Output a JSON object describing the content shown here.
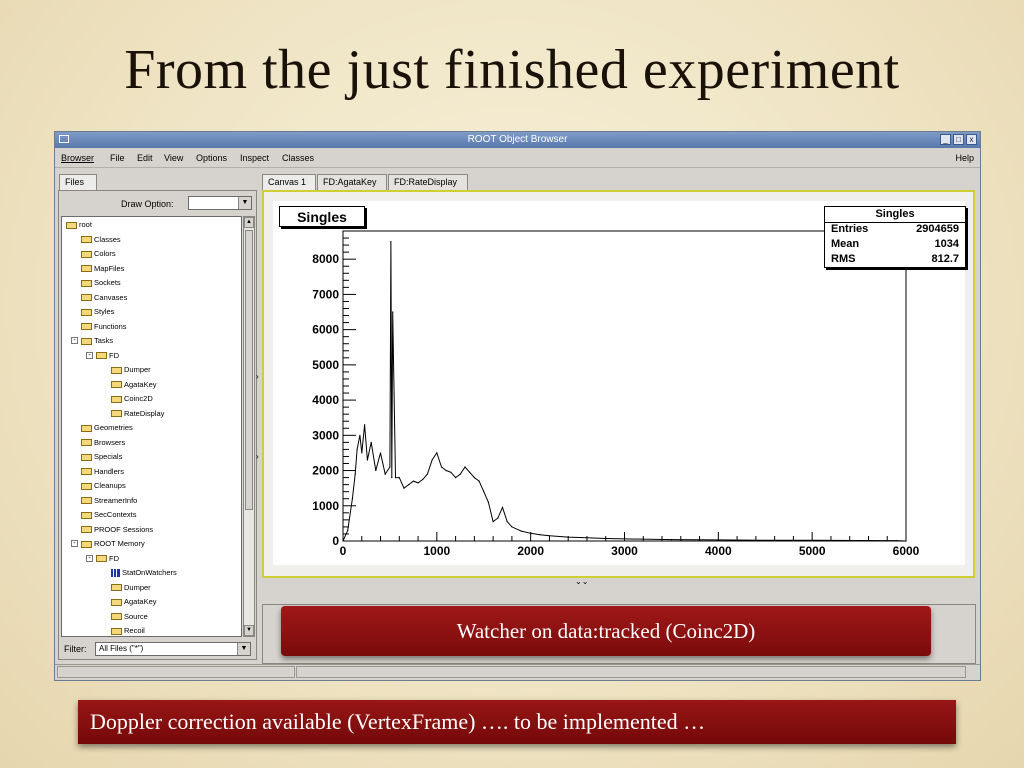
{
  "slide": {
    "title": "From the just finished experiment",
    "banner_watcher": "Watcher on data:tracked (Coinc2D)",
    "banner_doppler": "Doppler correction available (VertexFrame) …. to be implemented …"
  },
  "window": {
    "title": "ROOT Object Browser",
    "controls": [
      "_",
      "□",
      "x"
    ],
    "menu": [
      "Browser",
      "File",
      "Edit",
      "View",
      "Options",
      "Inspect",
      "Classes"
    ],
    "help": "Help"
  },
  "left": {
    "tab": "Files",
    "draw_option_label": "Draw Option:",
    "draw_option_value": "",
    "filter_label": "Filter:",
    "filter_value": "All Files (\"*\")",
    "tree": [
      {
        "label": "root",
        "icon": "folder-open-icon"
      },
      {
        "label": "Classes",
        "icon": "folder-icon"
      },
      {
        "label": "Colors",
        "icon": "folder-icon"
      },
      {
        "label": "MapFiles",
        "icon": "folder-icon"
      },
      {
        "label": "Sockets",
        "icon": "folder-icon"
      },
      {
        "label": "Canvases",
        "icon": "folder-icon"
      },
      {
        "label": "Styles",
        "icon": "folder-icon"
      },
      {
        "label": "Functions",
        "icon": "folder-icon"
      },
      {
        "label": "Tasks",
        "icon": "folder-open-icon",
        "expander": "-"
      },
      {
        "label": "FD",
        "icon": "folder-open-icon",
        "expander": "-"
      },
      {
        "label": "Dumper",
        "icon": "folder-icon"
      },
      {
        "label": "AgataKey",
        "icon": "folder-icon"
      },
      {
        "label": "Coinc2D",
        "icon": "folder-icon"
      },
      {
        "label": "RateDisplay",
        "icon": "folder-icon"
      },
      {
        "label": "Geometries",
        "icon": "folder-icon"
      },
      {
        "label": "Browsers",
        "icon": "folder-icon"
      },
      {
        "label": "Specials",
        "icon": "folder-icon"
      },
      {
        "label": "Handlers",
        "icon": "folder-icon"
      },
      {
        "label": "Cleanups",
        "icon": "folder-icon"
      },
      {
        "label": "StreamerInfo",
        "icon": "folder-icon"
      },
      {
        "label": "SecContexts",
        "icon": "folder-icon"
      },
      {
        "label": "PROOF Sessions",
        "icon": "folder-icon"
      },
      {
        "label": "ROOT Memory",
        "icon": "folder-open-icon",
        "expander": "-"
      },
      {
        "label": "FD",
        "icon": "folder-open-icon",
        "expander": "-"
      },
      {
        "label": "StatOnWatchers",
        "icon": "histogram-icon"
      },
      {
        "label": "Dumper",
        "icon": "folder-icon"
      },
      {
        "label": "AgataKey",
        "icon": "folder-icon"
      },
      {
        "label": "Source",
        "icon": "folder-icon"
      },
      {
        "label": "Recoil",
        "icon": "folder-icon"
      }
    ]
  },
  "right": {
    "tabs": [
      "Canvas 1",
      "FD:AgataKey",
      "FD:RateDisplay"
    ]
  },
  "histogram": {
    "name": "Singles",
    "stats_title": "Singles",
    "stats": [
      {
        "label": "Entries",
        "value": "2904659"
      },
      {
        "label": "Mean",
        "value": "1034"
      },
      {
        "label": "RMS",
        "value": "812.7"
      }
    ]
  },
  "chart_data": {
    "type": "line",
    "title": "Singles",
    "xlim": [
      0,
      6000
    ],
    "ylim": [
      0,
      8800
    ],
    "xticks": [
      "0",
      "1000",
      "2000",
      "3000",
      "4000",
      "5000",
      "6000"
    ],
    "yticks": [
      "0",
      "1000",
      "2000",
      "3000",
      "4000",
      "5000",
      "6000",
      "7000",
      "8000"
    ],
    "x": [
      0,
      50,
      100,
      130,
      150,
      180,
      200,
      230,
      260,
      300,
      350,
      400,
      450,
      500,
      510,
      520,
      530,
      560,
      600,
      650,
      700,
      750,
      800,
      850,
      900,
      950,
      1000,
      1050,
      1100,
      1150,
      1200,
      1250,
      1300,
      1350,
      1400,
      1450,
      1500,
      1550,
      1600,
      1650,
      1700,
      1750,
      1800,
      1900,
      2000,
      2100,
      2200,
      2400,
      2600,
      2800,
      3000,
      3500,
      4000,
      4500,
      5000,
      5500,
      5900,
      6000
    ],
    "y": [
      0,
      300,
      1200,
      1900,
      2600,
      3000,
      2500,
      3300,
      2300,
      2800,
      2000,
      2500,
      1900,
      2100,
      8500,
      1800,
      6500,
      1800,
      1800,
      1500,
      1600,
      1700,
      1650,
      1750,
      1900,
      2300,
      2500,
      2100,
      2000,
      1950,
      1800,
      1900,
      2100,
      1950,
      1800,
      1700,
      1400,
      1100,
      550,
      650,
      950,
      550,
      400,
      280,
      220,
      180,
      150,
      110,
      90,
      70,
      60,
      40,
      30,
      20,
      20,
      15,
      10,
      0
    ],
    "grid": false,
    "legend": "none"
  },
  "status": {
    "lower_panel_arrows": "⌄⌄"
  }
}
